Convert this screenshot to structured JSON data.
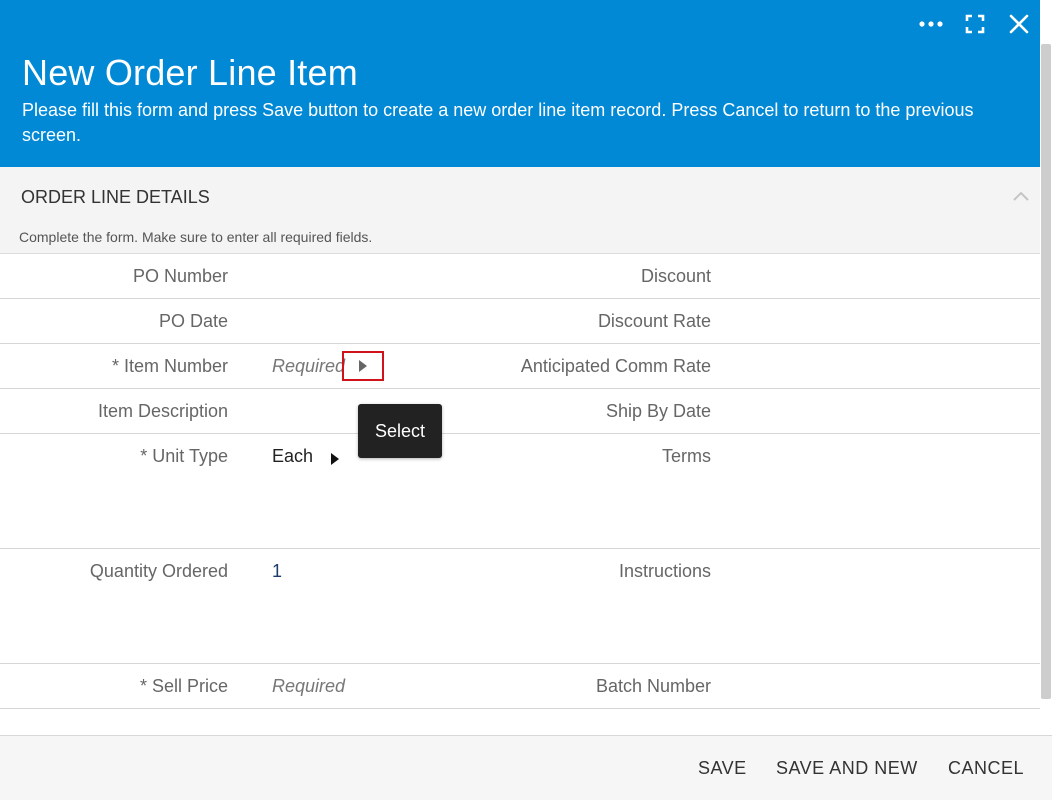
{
  "dialog": {
    "title": "New Order Line Item",
    "subtitle": "Please fill this form and press Save button to create a new order line item record. Press Cancel to return to the previous screen.",
    "controls": [
      "more-icon",
      "expand-icon",
      "close-icon"
    ]
  },
  "section": {
    "title": "ORDER LINE DETAILS",
    "hint": "Complete the form. Make sure to enter all required fields."
  },
  "fields": {
    "po_number": {
      "label": "PO Number",
      "value": ""
    },
    "po_date": {
      "label": "PO Date",
      "value": ""
    },
    "item_number": {
      "label": "* Item Number",
      "placeholder": "Required"
    },
    "item_description": {
      "label": "Item Description",
      "value": ""
    },
    "unit_type": {
      "label": "* Unit Type",
      "value": "Each"
    },
    "quantity_ordered": {
      "label": "Quantity Ordered",
      "value": "1"
    },
    "sell_price": {
      "label": "* Sell Price",
      "placeholder": "Required"
    },
    "discount": {
      "label": "Discount",
      "value": ""
    },
    "discount_rate": {
      "label": "Discount Rate",
      "value": ""
    },
    "anticipated_comm_rate": {
      "label": "Anticipated Comm Rate",
      "value": ""
    },
    "ship_by_date": {
      "label": "Ship By Date",
      "value": ""
    },
    "terms": {
      "label": "Terms",
      "value": ""
    },
    "instructions": {
      "label": "Instructions",
      "value": ""
    },
    "batch_number": {
      "label": "Batch Number",
      "value": ""
    }
  },
  "tooltip": {
    "text": "Select"
  },
  "footer": {
    "save": "SAVE",
    "save_and_new": "SAVE AND NEW",
    "cancel": "CANCEL"
  },
  "colors": {
    "header_bg": "#0189d6",
    "highlight_border": "#d0121b",
    "tooltip_bg": "#222222"
  }
}
